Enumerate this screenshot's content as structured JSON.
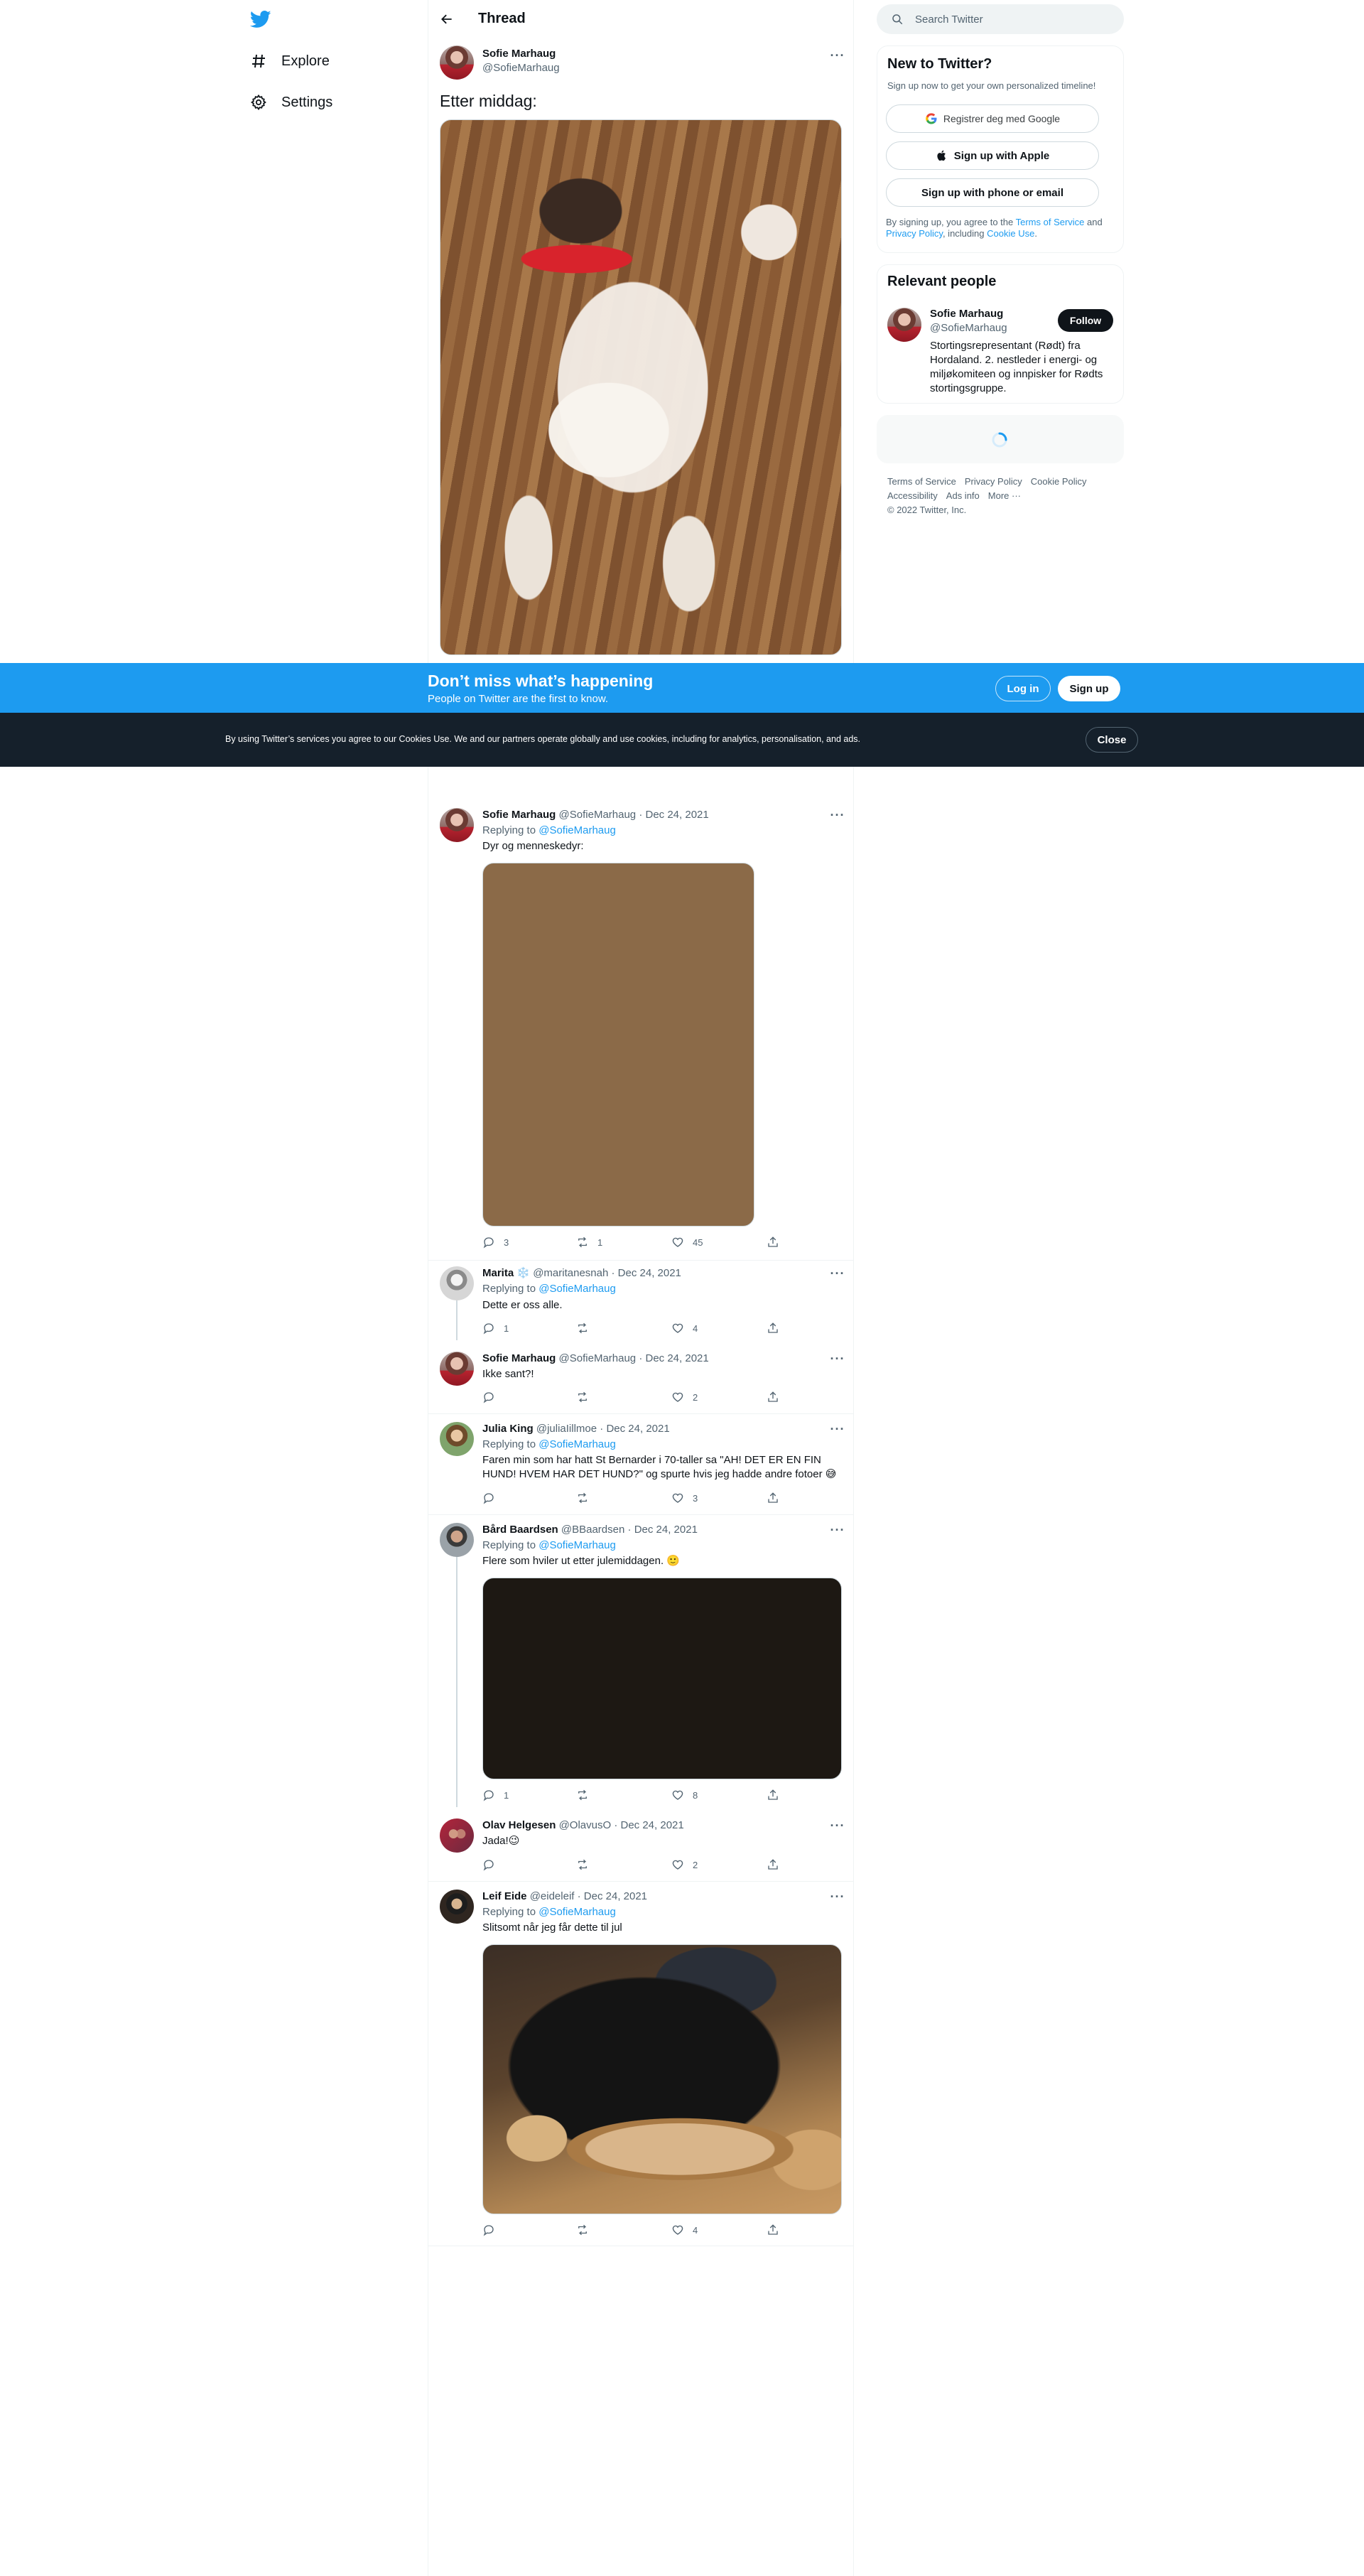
{
  "nav": {
    "logo": "twitter-bird-icon",
    "items": [
      {
        "label": "Explore",
        "icon": "hashtag-icon"
      },
      {
        "label": "Settings",
        "icon": "gear-icon"
      }
    ]
  },
  "header": {
    "title": "Thread"
  },
  "main_tweet": {
    "name": "Sofie Marhaug",
    "handle": "@SofieMarhaug",
    "text": "Etter middag:"
  },
  "banner": {
    "title": "Don’t miss what’s happening",
    "subtitle": "People on Twitter are the first to know.",
    "login": "Log in",
    "signup": "Sign up"
  },
  "cookie": {
    "text": "By using Twitter’s services you agree to our Cookies Use. We and our partners operate globally and use cookies, including for analytics, personalisation, and ads.",
    "close": "Close"
  },
  "replies": [
    {
      "name": "Sofie Marhaug",
      "handle": "@SofieMarhaug",
      "date": "Dec 24, 2021",
      "replying_to": "@SofieMarhaug",
      "text": "Dyr og menneskedyr:",
      "comments": "3",
      "retweets": "1",
      "likes": "45"
    },
    {
      "name": "Marita ❄️",
      "handle": "@maritanesnah",
      "date": "Dec 24, 2021",
      "replying_to": "@SofieMarhaug",
      "text": "Dette er oss alle.",
      "comments": "1",
      "retweets": "",
      "likes": "4"
    },
    {
      "name": "Sofie Marhaug",
      "handle": "@SofieMarhaug",
      "date": "Dec 24, 2021",
      "text": "Ikke sant?!",
      "comments": "",
      "retweets": "",
      "likes": "2"
    },
    {
      "name": "Julia King",
      "handle": "@juliaIillmoe",
      "date": "Dec 24, 2021",
      "replying_to": "@SofieMarhaug",
      "text": "Faren min som har hatt St Bernarder i 70-taller sa \"AH! DET ER EN FIN HUND! HVEM HAR DET HUND?\" og spurte hvis jeg hadde andre fotoer 😅",
      "comments": "",
      "retweets": "",
      "likes": "3"
    },
    {
      "name": "Bård Baardsen",
      "handle": "@BBaardsen",
      "date": "Dec 24, 2021",
      "replying_to": "@SofieMarhaug",
      "text": "Flere som hviler ut etter julemiddagen. 🙂",
      "comments": "1",
      "retweets": "",
      "likes": "8"
    },
    {
      "name": "Olav Helgesen",
      "handle": "@OlavusO",
      "date": "Dec 24, 2021",
      "text": "Jada!😉",
      "comments": "",
      "retweets": "",
      "likes": "2"
    },
    {
      "name": "Leif Eide",
      "handle": "@eideleif",
      "date": "Dec 24, 2021",
      "replying_to": "@SofieMarhaug",
      "text": "Slitsomt når jeg får dette til jul",
      "comments": "",
      "retweets": "",
      "likes": "4"
    }
  ],
  "labels": {
    "replying": "Replying to",
    "sep": " · "
  },
  "right": {
    "search_placeholder": "Search Twitter",
    "new_title": "New to Twitter?",
    "new_sub": "Sign up now to get your own personalized timeline!",
    "google_btn": "Registrer deg med Google",
    "apple_btn": "Sign up with Apple",
    "phone_btn": "Sign up with phone or email",
    "legal": {
      "pre": "By signing up, you agree to the ",
      "tos": "Terms of Service",
      "and": " and ",
      "privacy": "Privacy Policy",
      "including": ", including ",
      "cookie": "Cookie Use",
      "end": "."
    },
    "relevant_title": "Relevant people",
    "person": {
      "name": "Sofie Marhaug",
      "handle": "@SofieMarhaug",
      "follow": "Follow",
      "bio": "Stortingsrepresentant (Rødt) fra Hordaland. 2. nestleder i energi- og miljøkomiteen og innpisker for Rødts stortingsgruppe."
    },
    "footer": [
      "Terms of Service",
      "Privacy Policy",
      "Cookie Policy",
      "Accessibility",
      "Ads info",
      "More ···",
      "© 2022 Twitter, Inc."
    ]
  },
  "colors": {
    "accent": "#1d9bf0",
    "text": "#0f1419",
    "muted": "#536471",
    "cookie_bg": "#15202b"
  }
}
